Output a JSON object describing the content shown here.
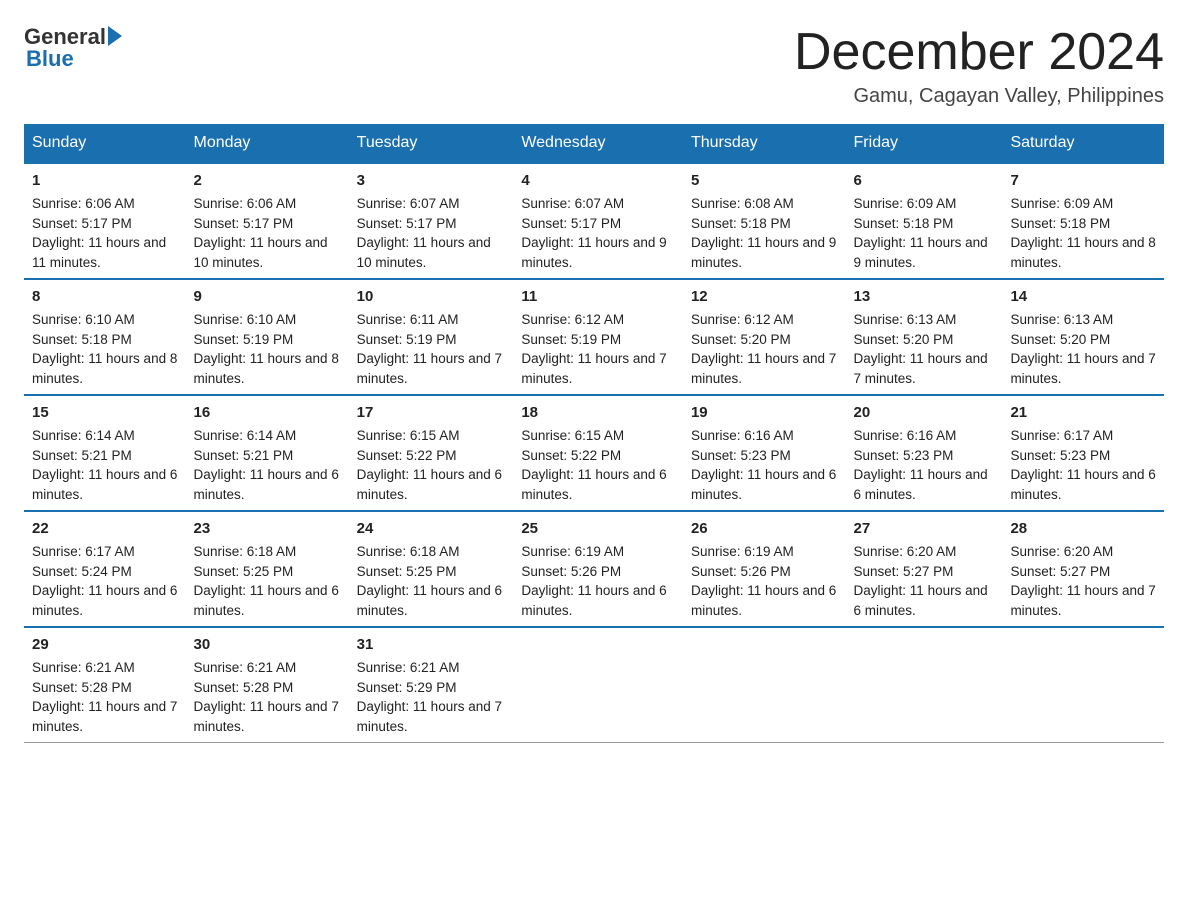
{
  "header": {
    "logo_general": "General",
    "logo_blue": "Blue",
    "title": "December 2024",
    "location": "Gamu, Cagayan Valley, Philippines"
  },
  "columns": [
    "Sunday",
    "Monday",
    "Tuesday",
    "Wednesday",
    "Thursday",
    "Friday",
    "Saturday"
  ],
  "weeks": [
    [
      {
        "day": "1",
        "sunrise": "6:06 AM",
        "sunset": "5:17 PM",
        "daylight": "11 hours and 11 minutes."
      },
      {
        "day": "2",
        "sunrise": "6:06 AM",
        "sunset": "5:17 PM",
        "daylight": "11 hours and 10 minutes."
      },
      {
        "day": "3",
        "sunrise": "6:07 AM",
        "sunset": "5:17 PM",
        "daylight": "11 hours and 10 minutes."
      },
      {
        "day": "4",
        "sunrise": "6:07 AM",
        "sunset": "5:17 PM",
        "daylight": "11 hours and 9 minutes."
      },
      {
        "day": "5",
        "sunrise": "6:08 AM",
        "sunset": "5:18 PM",
        "daylight": "11 hours and 9 minutes."
      },
      {
        "day": "6",
        "sunrise": "6:09 AM",
        "sunset": "5:18 PM",
        "daylight": "11 hours and 9 minutes."
      },
      {
        "day": "7",
        "sunrise": "6:09 AM",
        "sunset": "5:18 PM",
        "daylight": "11 hours and 8 minutes."
      }
    ],
    [
      {
        "day": "8",
        "sunrise": "6:10 AM",
        "sunset": "5:18 PM",
        "daylight": "11 hours and 8 minutes."
      },
      {
        "day": "9",
        "sunrise": "6:10 AM",
        "sunset": "5:19 PM",
        "daylight": "11 hours and 8 minutes."
      },
      {
        "day": "10",
        "sunrise": "6:11 AM",
        "sunset": "5:19 PM",
        "daylight": "11 hours and 7 minutes."
      },
      {
        "day": "11",
        "sunrise": "6:12 AM",
        "sunset": "5:19 PM",
        "daylight": "11 hours and 7 minutes."
      },
      {
        "day": "12",
        "sunrise": "6:12 AM",
        "sunset": "5:20 PM",
        "daylight": "11 hours and 7 minutes."
      },
      {
        "day": "13",
        "sunrise": "6:13 AM",
        "sunset": "5:20 PM",
        "daylight": "11 hours and 7 minutes."
      },
      {
        "day": "14",
        "sunrise": "6:13 AM",
        "sunset": "5:20 PM",
        "daylight": "11 hours and 7 minutes."
      }
    ],
    [
      {
        "day": "15",
        "sunrise": "6:14 AM",
        "sunset": "5:21 PM",
        "daylight": "11 hours and 6 minutes."
      },
      {
        "day": "16",
        "sunrise": "6:14 AM",
        "sunset": "5:21 PM",
        "daylight": "11 hours and 6 minutes."
      },
      {
        "day": "17",
        "sunrise": "6:15 AM",
        "sunset": "5:22 PM",
        "daylight": "11 hours and 6 minutes."
      },
      {
        "day": "18",
        "sunrise": "6:15 AM",
        "sunset": "5:22 PM",
        "daylight": "11 hours and 6 minutes."
      },
      {
        "day": "19",
        "sunrise": "6:16 AM",
        "sunset": "5:23 PM",
        "daylight": "11 hours and 6 minutes."
      },
      {
        "day": "20",
        "sunrise": "6:16 AM",
        "sunset": "5:23 PM",
        "daylight": "11 hours and 6 minutes."
      },
      {
        "day": "21",
        "sunrise": "6:17 AM",
        "sunset": "5:23 PM",
        "daylight": "11 hours and 6 minutes."
      }
    ],
    [
      {
        "day": "22",
        "sunrise": "6:17 AM",
        "sunset": "5:24 PM",
        "daylight": "11 hours and 6 minutes."
      },
      {
        "day": "23",
        "sunrise": "6:18 AM",
        "sunset": "5:25 PM",
        "daylight": "11 hours and 6 minutes."
      },
      {
        "day": "24",
        "sunrise": "6:18 AM",
        "sunset": "5:25 PM",
        "daylight": "11 hours and 6 minutes."
      },
      {
        "day": "25",
        "sunrise": "6:19 AM",
        "sunset": "5:26 PM",
        "daylight": "11 hours and 6 minutes."
      },
      {
        "day": "26",
        "sunrise": "6:19 AM",
        "sunset": "5:26 PM",
        "daylight": "11 hours and 6 minutes."
      },
      {
        "day": "27",
        "sunrise": "6:20 AM",
        "sunset": "5:27 PM",
        "daylight": "11 hours and 6 minutes."
      },
      {
        "day": "28",
        "sunrise": "6:20 AM",
        "sunset": "5:27 PM",
        "daylight": "11 hours and 7 minutes."
      }
    ],
    [
      {
        "day": "29",
        "sunrise": "6:21 AM",
        "sunset": "5:28 PM",
        "daylight": "11 hours and 7 minutes."
      },
      {
        "day": "30",
        "sunrise": "6:21 AM",
        "sunset": "5:28 PM",
        "daylight": "11 hours and 7 minutes."
      },
      {
        "day": "31",
        "sunrise": "6:21 AM",
        "sunset": "5:29 PM",
        "daylight": "11 hours and 7 minutes."
      },
      {
        "day": "",
        "sunrise": "",
        "sunset": "",
        "daylight": ""
      },
      {
        "day": "",
        "sunrise": "",
        "sunset": "",
        "daylight": ""
      },
      {
        "day": "",
        "sunrise": "",
        "sunset": "",
        "daylight": ""
      },
      {
        "day": "",
        "sunrise": "",
        "sunset": "",
        "daylight": ""
      }
    ]
  ]
}
